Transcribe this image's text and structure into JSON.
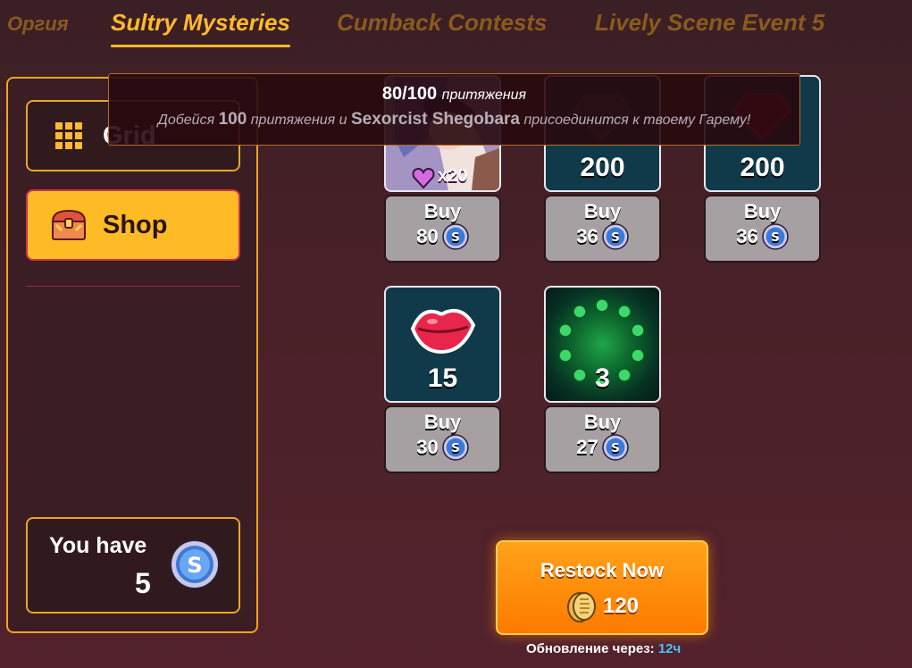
{
  "tabs": [
    {
      "label": "Оргия",
      "active": false
    },
    {
      "label": "Sultry Mysteries",
      "active": true
    },
    {
      "label": "Cumback Contests",
      "active": false
    },
    {
      "label": "Lively Scene Event 5",
      "active": false
    }
  ],
  "sidebar": {
    "grid_label": "Grid",
    "shop_label": "Shop",
    "you_have_label": "You have",
    "you_have_value": "5"
  },
  "tooltip": {
    "progress": "80/100",
    "progress_suffix": "притяжения",
    "desc_pre": "Добейся",
    "desc_amount": "100",
    "desc_mid": "притяжения и",
    "desc_name": "Sexorcist Shegobara",
    "desc_post": "присоединится к твоему Гарему!"
  },
  "items": [
    {
      "qty": "x20",
      "buy_label": "Buy",
      "price": "80",
      "icon": "girl-portrait-affection"
    },
    {
      "qty": "200",
      "buy_label": "Buy",
      "price": "36",
      "icon": "dark-gem-icon"
    },
    {
      "qty": "200",
      "buy_label": "Buy",
      "price": "36",
      "icon": "red-gem-icon"
    },
    {
      "qty": "15",
      "buy_label": "Buy",
      "price": "30",
      "icon": "kiss-lips-icon"
    },
    {
      "qty": "3",
      "buy_label": "Buy",
      "price": "27",
      "icon": "green-orbs-icon"
    }
  ],
  "restock": {
    "label": "Restock Now",
    "cost": "120"
  },
  "timer": {
    "label": "Обновление через:",
    "value": "12ч"
  },
  "colors": {
    "accent": "#ffb92e",
    "active_tab": "#ffb92e",
    "restock": "#ff8c00",
    "card_bg": "#103a49"
  }
}
